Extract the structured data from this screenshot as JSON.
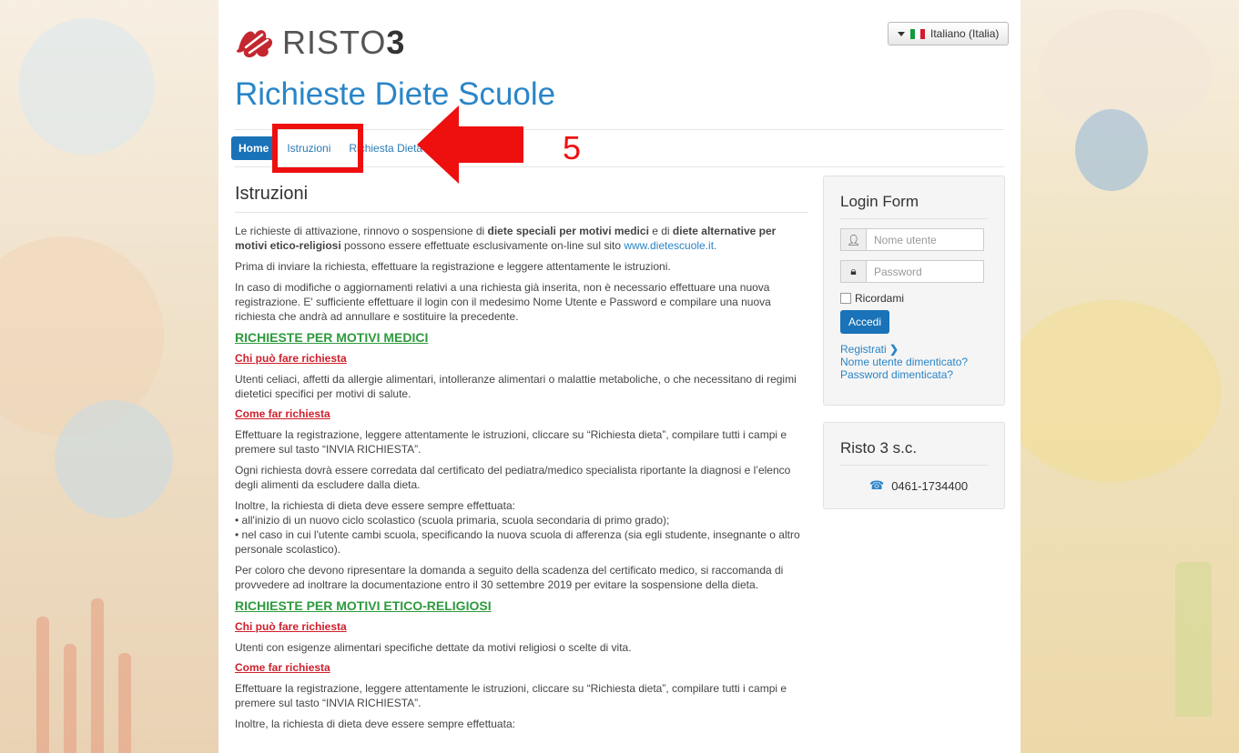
{
  "header": {
    "logo_text": "RISTO",
    "logo_num": "3",
    "site_title": "Richieste Diete Scuole",
    "language": "Italiano (Italia)"
  },
  "nav": {
    "home": "Home",
    "istruzioni": "Istruzioni",
    "richiesta": "Richiesta Dieta"
  },
  "annotation": {
    "number": "5",
    "color": "#ee0f0f"
  },
  "main": {
    "heading": "Istruzioni",
    "p1_a": "Le richieste di attivazione, rinnovo o sospensione di ",
    "p1_b": "diete speciali per motivi medici",
    "p1_c": " e di ",
    "p1_d": "diete alternative per motivi etico-religiosi",
    "p1_e": " possono essere effettuate esclusivamente on-line sul sito ",
    "p1_link": "www.dietescuole.it.",
    "p2": "Prima di inviare la richiesta, effettuare la registrazione e leggere attentamente le istruzioni.",
    "p3": "In caso di modifiche o aggiornamenti relativi a una richiesta già inserita, non è necessario effettuare una nuova registrazione. E' sufficiente effettuare il login con il medesimo Nome Utente e Password e compilare una nuova richiesta che andrà ad annullare e sostituire la precedente.",
    "sec1": "RICHIESTE PER MOTIVI MEDICI",
    "sub1": "Chi può fare richiesta",
    "p4": "Utenti celiaci, affetti da allergie alimentari, intolleranze alimentari o malattie metaboliche, o che necessitano di regimi dietetici specifici per motivi di salute.",
    "sub2": "Come far richiesta",
    "p5": "Effettuare la registrazione, leggere attentamente le istruzioni, cliccare su “Richiesta dieta”, compilare tutti i campi e premere sul tasto “INVIA RICHIESTA”.",
    "p6": "Ogni richiesta dovrà essere corredata dal certificato del pediatra/medico specialista riportante la diagnosi e l’elenco degli alimenti da escludere dalla dieta.",
    "p7_a": "Inoltre, la richiesta di dieta deve essere sempre effettuata:",
    "p7_b": "•   all'inizio di un nuovo ciclo scolastico (scuola primaria, scuola secondaria di primo grado);",
    "p7_c": "•   nel caso in cui l'utente cambi scuola, specificando la nuova scuola di afferenza (sia egli studente, insegnante o altro personale scolastico).",
    "p8": "Per coloro che devono ripresentare la domanda a seguito della scadenza del certificato medico, si raccomanda di provvedere ad inoltrare la documentazione entro il 30 settembre 2019 per evitare la sospensione della dieta.",
    "sec2": "RICHIESTE PER MOTIVI ETICO-RELIGIOSI",
    "sub3": "Chi può fare richiesta",
    "p9": "Utenti con esigenze alimentari specifiche dettate da motivi religiosi o scelte di vita.",
    "sub4": "Come far richiesta",
    "p10": "Effettuare la registrazione, leggere attentamente le istruzioni, cliccare su “Richiesta dieta”, compilare tutti i campi e premere sul tasto “INVIA RICHIESTA”.",
    "p11": "Inoltre, la richiesta di dieta deve essere sempre effettuata:"
  },
  "login": {
    "title": "Login Form",
    "username_placeholder": "Nome utente",
    "password_placeholder": "Password",
    "remember": "Ricordami",
    "submit": "Accedi",
    "register": "Registrati",
    "forgot_user": "Nome utente dimenticato?",
    "forgot_password": "Password dimenticata?"
  },
  "contact": {
    "title": "Risto 3 s.c.",
    "phone": "0461-1734400"
  },
  "colors": {
    "primary": "#1a73b8",
    "link": "#2a85c7",
    "section_green": "#2e9a3d",
    "sub_red": "#d01f2b"
  }
}
